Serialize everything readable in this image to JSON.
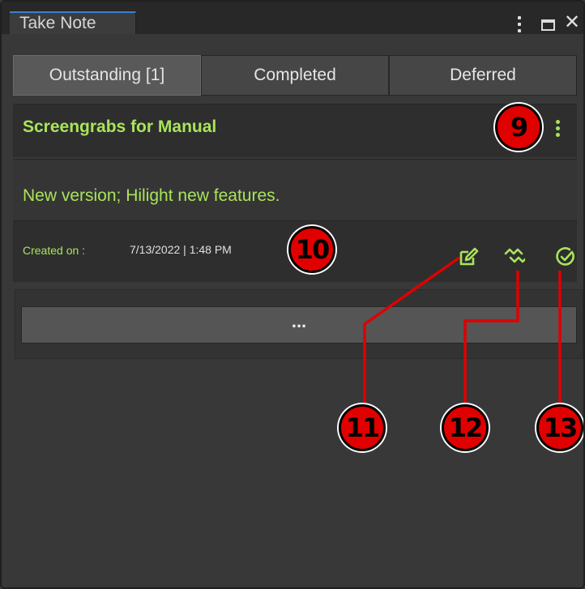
{
  "window": {
    "title": "Take Note",
    "menu_icon": "kebab-menu-icon",
    "maximize_icon": "maximize-icon",
    "close_icon": "close-icon",
    "close_glyph": "✕"
  },
  "tabs": [
    {
      "label": "Outstanding [1]",
      "active": true
    },
    {
      "label": "Completed",
      "active": false
    },
    {
      "label": "Deferred",
      "active": false
    }
  ],
  "note": {
    "title": "Screengrabs for Manual",
    "description": "New version; Hilight new features.",
    "created_label": "Created on :",
    "created_date": "7/13/2022 | 1:48 PM",
    "menu_icon": "kebab-menu-icon",
    "actions": [
      {
        "name": "edit",
        "icon": "edit-icon"
      },
      {
        "name": "defer",
        "icon": "defer-icon"
      },
      {
        "name": "complete",
        "icon": "check-circle-icon"
      }
    ]
  },
  "more_button": {
    "label": "..."
  },
  "annotations": [
    "9",
    "10",
    "11",
    "12",
    "13"
  ],
  "colors": {
    "accent_text": "#a9e45a",
    "callout_fill": "#e00000",
    "leader_line": "#e00000",
    "tab_active_border": "#3d7fd1"
  }
}
